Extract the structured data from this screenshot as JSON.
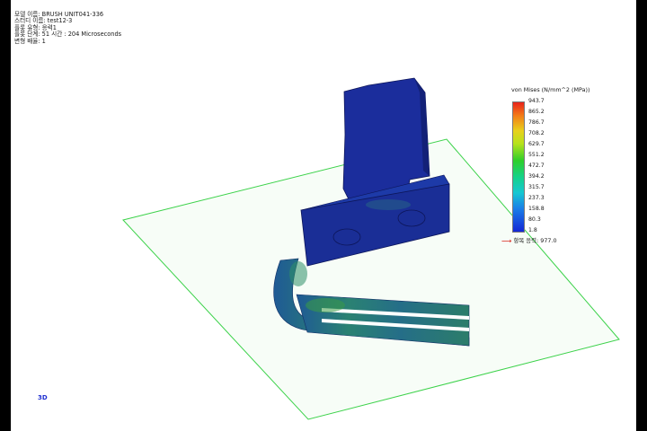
{
  "info": {
    "model_name": "모델 이름: BRUSH UNIT041-336",
    "study_name": "스터디 이름: test12-3",
    "plot_type": "플롯 유형: 응력1",
    "plot_step": "플롯 단계: 51   시간 : 204 Microseconds",
    "deform_scale": "변형 배율: 1"
  },
  "legend": {
    "title": "von Mises (N/mm^2 (MPa))",
    "ticks": [
      "943.7",
      "865.2",
      "786.7",
      "708.2",
      "629.7",
      "551.2",
      "472.7",
      "394.2",
      "315.7",
      "237.3",
      "158.8",
      "80.3",
      "1.8"
    ],
    "yield_strength": "항복 응력: 977.0",
    "max_color": "#e8231b",
    "min_color": "#1427d6"
  },
  "triad_label": "3D",
  "colors": {
    "ground_plane_edge": "#3cd24a",
    "ground_plane_fill": "#eef9ee",
    "model_dark": "#16228a",
    "model_mid": "#1b3ea0",
    "strip_stress": "#2a8a7a"
  }
}
